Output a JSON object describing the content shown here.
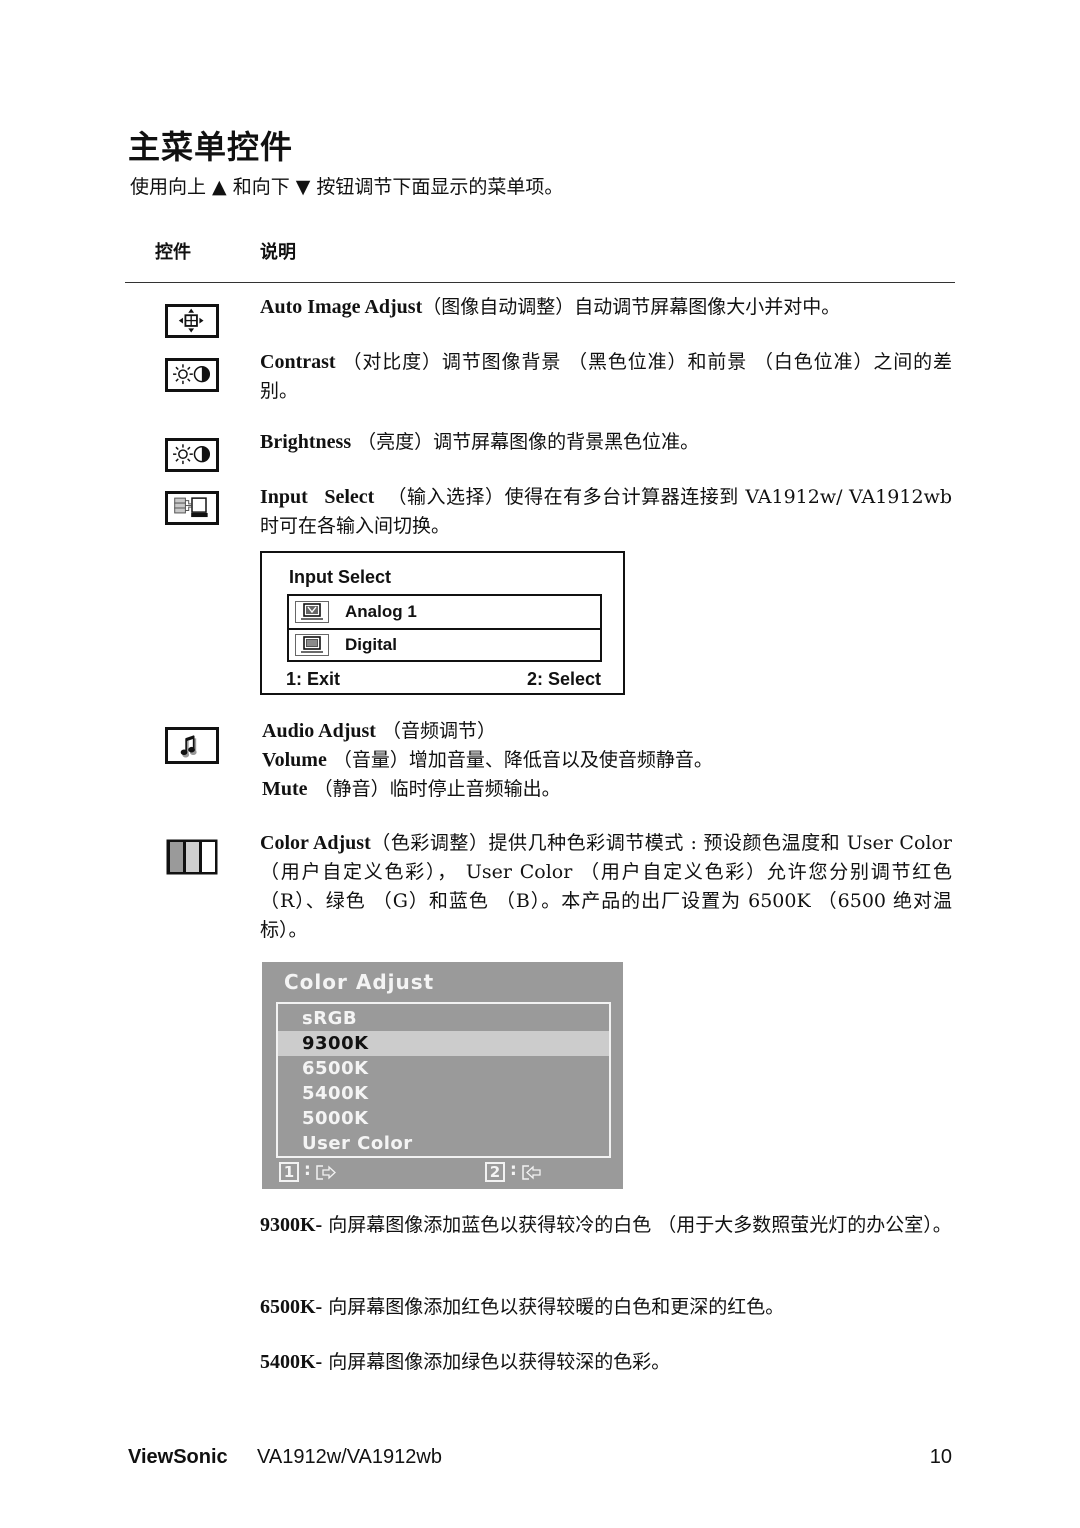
{
  "page": {
    "title": "主菜单控件",
    "subtitle": "使用向上 ▲ 和向下 ▼ 按钮调节下面显示的菜单项。",
    "column_headers": {
      "control": "控件",
      "description": "说明"
    }
  },
  "items": {
    "auto_image_adjust": {
      "icon": "auto-image-adjust-icon",
      "term": "Auto Image Adjust",
      "text": "（图像自动调整）自动调节屏幕图像大小并对中。"
    },
    "contrast": {
      "icon": "contrast-icon",
      "term": "Contrast",
      "text": " （对比度）调节图像背景 （黑色位准）和前景 （白色位准）之间的差别。"
    },
    "brightness": {
      "icon": "brightness-icon",
      "term": "Brightness",
      "text": " （亮度）调节屏幕图像的背景黑色位准。"
    },
    "input_select": {
      "icon": "input-select-icon",
      "term": "Input   Select",
      "text": "  （输入选择）使得在有多台计算器连接到 VA1912w/ VA1912wb 时可在各输入间切换。"
    },
    "audio_adjust": {
      "icon": "audio-adjust-icon",
      "term": "Audio Adjust",
      "text": " （音频调节）",
      "volume_term": "Volume",
      "volume_text": " （音量）增加音量、降低音以及使音频静音。",
      "mute_term": "Mute",
      "mute_text": " （静音）临时停止音频输出。"
    },
    "color_adjust": {
      "icon": "color-adjust-icon",
      "term": "Color Adjust",
      "text": "（色彩调整）提供几种色彩调节模式 : 预设颜色温度和 User Color （用户自定义色彩）， User Color （用户自定义色彩）允许您分别调节红色 （R）、绿色 （G）和蓝色 （B）。本产品的出厂设置为 6500K （6500 绝对温标）。"
    }
  },
  "input_select_osd": {
    "title": "Input Select",
    "options": [
      {
        "label": "Analog 1",
        "icon": "analog-monitor-icon",
        "selected": true
      },
      {
        "label": "Digital",
        "icon": "digital-monitor-icon",
        "selected": false
      }
    ],
    "footer_left": "1: Exit",
    "footer_right": "2: Select"
  },
  "color_adjust_osd": {
    "title": "Color Adjust",
    "options": [
      "sRGB",
      "9300K",
      "6500K",
      "5400K",
      "5000K",
      "User Color"
    ],
    "selected": "9300K",
    "key1": "1",
    "key2": "2",
    "colon": ":",
    "colors": {
      "panel": "#9a9a9a",
      "highlight": "#cccccc",
      "text": "#f4f4f4"
    }
  },
  "presets": {
    "p9300": {
      "term": "9300K-",
      "text": " 向屏幕图像添加蓝色以获得较冷的白色 （用于大多数照萤光灯的办公室）。"
    },
    "p6500": {
      "term": "6500K-",
      "text": " 向屏幕图像添加红色以获得较暖的白色和更深的红色。"
    },
    "p5400": {
      "term": "5400K-",
      "text": " 向屏幕图像添加绿色以获得较深的色彩。"
    }
  },
  "footer": {
    "brand": "ViewSonic",
    "model": "VA1912w/VA1912wb",
    "page_number": "10"
  }
}
